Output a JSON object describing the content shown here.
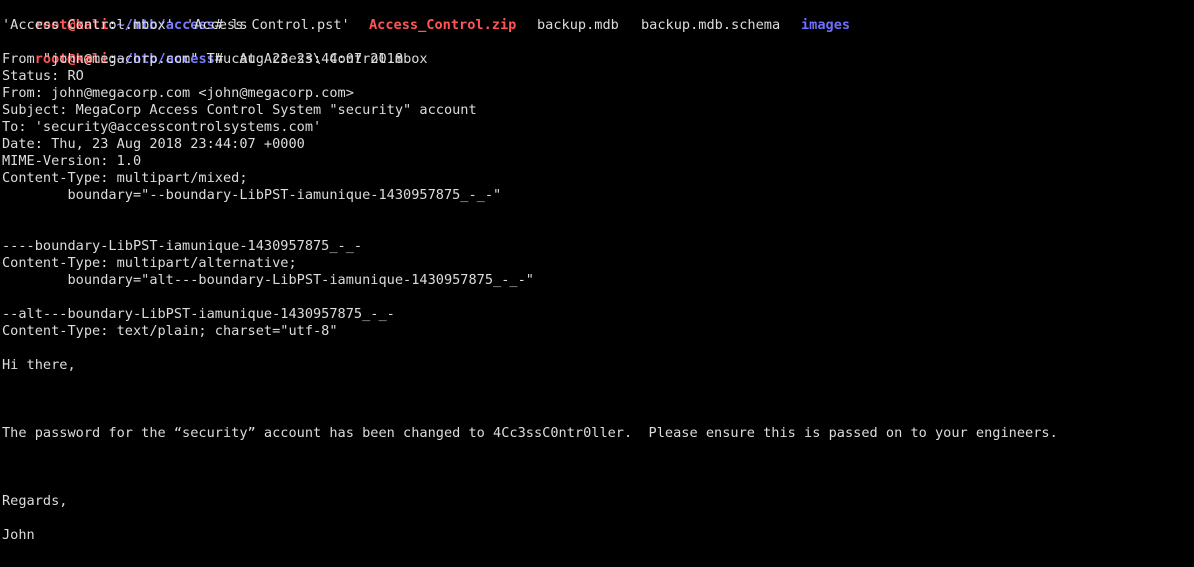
{
  "prompt": {
    "user": "root@kali",
    "sep": ":",
    "path": "~/htb/access",
    "symbol": "#"
  },
  "commands": {
    "ls": " ls",
    "cat": " cat Access\\ Control.mbox"
  },
  "ls_output": [
    {
      "name": "'Access Control.mbox'",
      "type": "file"
    },
    {
      "name": "'Access Control.pst'",
      "type": "file"
    },
    {
      "name": "Access_Control.zip",
      "type": "archive"
    },
    {
      "name": "backup.mdb",
      "type": "file"
    },
    {
      "name": "backup.mdb.schema",
      "type": "file"
    },
    {
      "name": "images",
      "type": "directory"
    }
  ],
  "mbox_lines": [
    "From \"john@megacorp.com\" Thu Aug 23 23:44:07 2018",
    "Status: RO",
    "From: john@megacorp.com <john@megacorp.com>",
    "Subject: MegaCorp Access Control System \"security\" account",
    "To: 'security@accesscontrolsystems.com'",
    "Date: Thu, 23 Aug 2018 23:44:07 +0000",
    "MIME-Version: 1.0",
    "Content-Type: multipart/mixed;",
    "        boundary=\"--boundary-LibPST-iamunique-1430957875_-_-\"",
    "",
    "",
    "----boundary-LibPST-iamunique-1430957875_-_-",
    "Content-Type: multipart/alternative;",
    "        boundary=\"alt---boundary-LibPST-iamunique-1430957875_-_-\"",
    "",
    "--alt---boundary-LibPST-iamunique-1430957875_-_-",
    "Content-Type: text/plain; charset=\"utf-8\"",
    "",
    "Hi there,",
    "",
    "",
    "",
    "The password for the “security” account has been changed to 4Cc3ssC0ntr0ller.  Please ensure this is passed on to your engineers.",
    "",
    "",
    "",
    "Regards,",
    "",
    "John"
  ]
}
